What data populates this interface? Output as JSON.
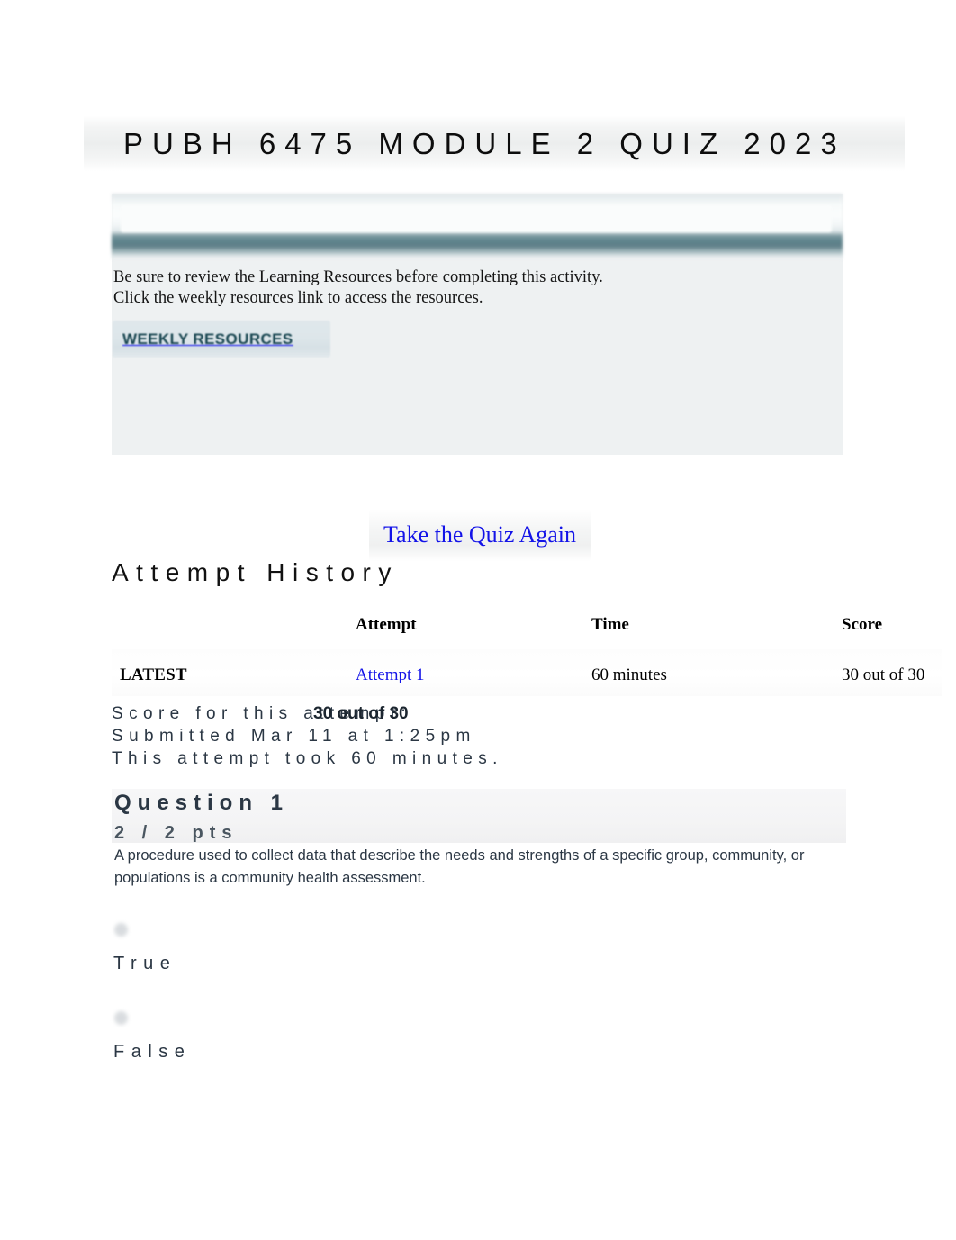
{
  "page": {
    "title": "PUBH 6475 MODULE 2 QUIZ 2023"
  },
  "resources": {
    "line1": "Be sure to review the Learning Resources before completing this activity.",
    "line2": "Click the weekly resources link to access the resources.",
    "button_label": "WEEKLY RESOURCES"
  },
  "actions": {
    "take_quiz_again": "Take the Quiz Again"
  },
  "attempt_history": {
    "heading": "Attempt History",
    "columns": [
      "",
      "Attempt",
      "Time",
      "Score"
    ],
    "rows": [
      {
        "kept": "LATEST",
        "attempt": "Attempt 1",
        "time": "60 minutes",
        "score": "30 out of 30"
      }
    ]
  },
  "score_summary": {
    "score_label": "Score for this attempt:",
    "score_value": "30 out of 30",
    "submitted": "Submitted Mar 11 at 1:25pm",
    "duration": "This attempt took 60 minutes."
  },
  "question": {
    "title": "Question 1",
    "points": "2 / 2 pts",
    "text": "A procedure used to collect data that describe the needs and strengths of a specific group, community, or populations is a community health assessment.",
    "options": [
      {
        "label": "True"
      },
      {
        "label": "False"
      }
    ]
  },
  "colors": {
    "link": "#1313e8",
    "teal": "#16444f",
    "panel_bg": "#eef1f2",
    "question_bg": "#f4f4f5",
    "body_text": "#2b3744"
  }
}
